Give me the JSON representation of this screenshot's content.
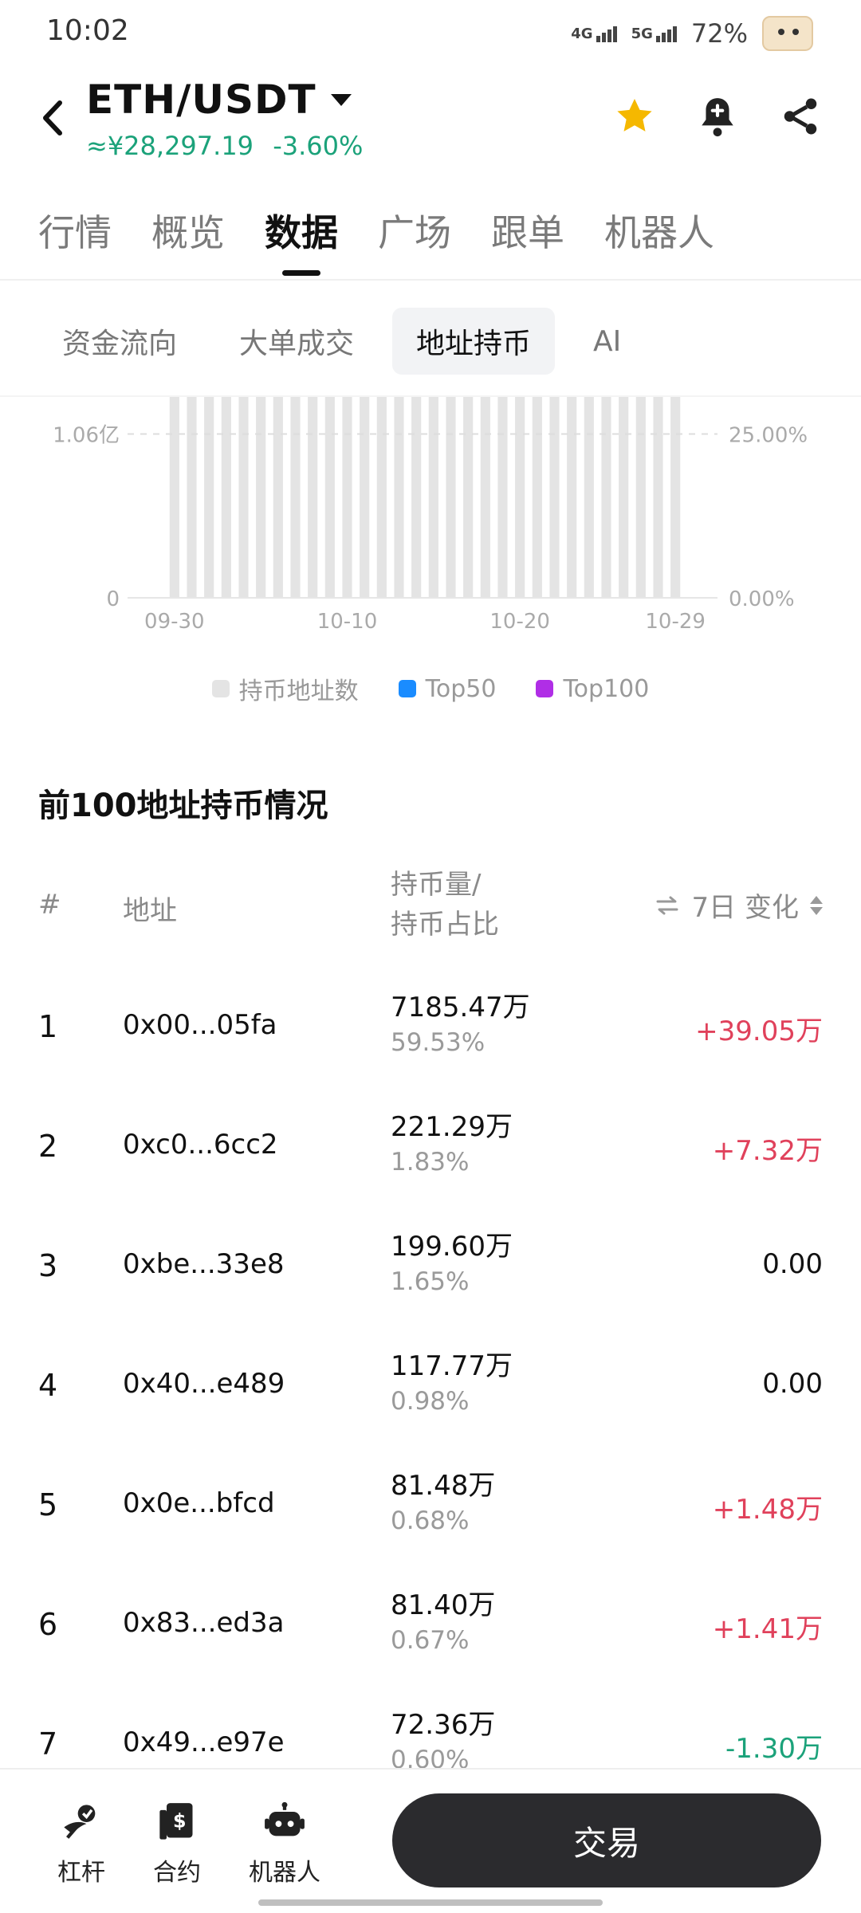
{
  "status_bar": {
    "time": "10:02",
    "net1": "4G",
    "net2": "5G",
    "battery": "72%"
  },
  "header": {
    "pair": "ETH/USDT",
    "price": "≈¥28,297.19",
    "change": "-3.60%",
    "icons": [
      "star-icon",
      "bell-icon",
      "share-icon"
    ],
    "colors": {
      "up": "#e0415b",
      "down": "#1ba27a",
      "star": "#f5b800"
    }
  },
  "main_tabs": [
    {
      "label": "行情",
      "active": false
    },
    {
      "label": "概览",
      "active": false
    },
    {
      "label": "数据",
      "active": true
    },
    {
      "label": "广场",
      "active": false
    },
    {
      "label": "跟单",
      "active": false
    },
    {
      "label": "机器人",
      "active": false
    }
  ],
  "sub_tabs": [
    {
      "label": "资金流向",
      "active": false
    },
    {
      "label": "大单成交",
      "active": false
    },
    {
      "label": "地址持币",
      "active": true
    },
    {
      "label": "AI",
      "active": false
    }
  ],
  "chart_data": {
    "type": "bar",
    "categories": [
      "09-30",
      "10-01",
      "10-02",
      "10-03",
      "10-04",
      "10-05",
      "10-06",
      "10-07",
      "10-08",
      "10-09",
      "10-10",
      "10-11",
      "10-12",
      "10-13",
      "10-14",
      "10-15",
      "10-16",
      "10-17",
      "10-18",
      "10-19",
      "10-20",
      "10-21",
      "10-22",
      "10-23",
      "10-24",
      "10-25",
      "10-26",
      "10-27",
      "10-28",
      "10-29"
    ],
    "x_tick_labels": [
      "09-30",
      "10-10",
      "10-20",
      "10-29"
    ],
    "series": [
      {
        "name": "持币地址数",
        "axis": "left",
        "values": [
          1.3,
          1.3,
          1.3,
          1.3,
          1.3,
          1.3,
          1.3,
          1.3,
          1.3,
          1.3,
          1.3,
          1.3,
          1.3,
          1.3,
          1.3,
          1.3,
          1.3,
          1.3,
          1.3,
          1.3,
          1.3,
          1.3,
          1.3,
          1.3,
          1.3,
          1.3,
          1.3,
          1.3,
          1.3,
          1.3
        ],
        "color": "#e4e4e4"
      }
    ],
    "left_axis": {
      "ticks": [
        "0",
        "1.06亿"
      ],
      "tick_values": [
        0,
        1.06
      ],
      "unit": "亿",
      "ylim": [
        0,
        1.3
      ]
    },
    "right_axis": {
      "ticks": [
        "0.00%",
        "25.00%"
      ],
      "tick_values": [
        0,
        25
      ],
      "ylim": [
        0,
        30.66
      ]
    },
    "grid": "dashed at 1.06亿 / 25.00%",
    "legend": [
      {
        "label": "持币地址数",
        "color": "#e4e4e4"
      },
      {
        "label": "Top50",
        "color": "#1a8cff"
      },
      {
        "label": "Top100",
        "color": "#b02ee6"
      }
    ],
    "legend_position": "bottom-center"
  },
  "holdings": {
    "title": "前100地址持币情况",
    "headers": {
      "index": "#",
      "address": "地址",
      "holding_line1": "持币量/",
      "holding_line2": "持币占比",
      "change": "7日 变化"
    },
    "rows": [
      {
        "index": "1",
        "address": "0x00...05fa",
        "amount": "7185.47万",
        "percent": "59.53%",
        "change": "+39.05万",
        "direction": "up"
      },
      {
        "index": "2",
        "address": "0xc0...6cc2",
        "amount": "221.29万",
        "percent": "1.83%",
        "change": "+7.32万",
        "direction": "up"
      },
      {
        "index": "3",
        "address": "0xbe...33e8",
        "amount": "199.60万",
        "percent": "1.65%",
        "change": "0.00",
        "direction": "flat"
      },
      {
        "index": "4",
        "address": "0x40...e489",
        "amount": "117.77万",
        "percent": "0.98%",
        "change": "0.00",
        "direction": "flat"
      },
      {
        "index": "5",
        "address": "0x0e...bfcd",
        "amount": "81.48万",
        "percent": "0.68%",
        "change": "+1.48万",
        "direction": "up"
      },
      {
        "index": "6",
        "address": "0x83...ed3a",
        "amount": "81.40万",
        "percent": "0.67%",
        "change": "+1.41万",
        "direction": "up"
      },
      {
        "index": "7",
        "address": "0x49...e97e",
        "amount": "72.36万",
        "percent": "0.60%",
        "change": "-1.30万",
        "direction": "down"
      }
    ]
  },
  "bottom_nav": {
    "items": [
      {
        "label": "杠杆",
        "icon": "leverage-icon"
      },
      {
        "label": "合约",
        "icon": "contract-icon"
      },
      {
        "label": "机器人",
        "icon": "robot-icon"
      }
    ],
    "trade_label": "交易"
  }
}
